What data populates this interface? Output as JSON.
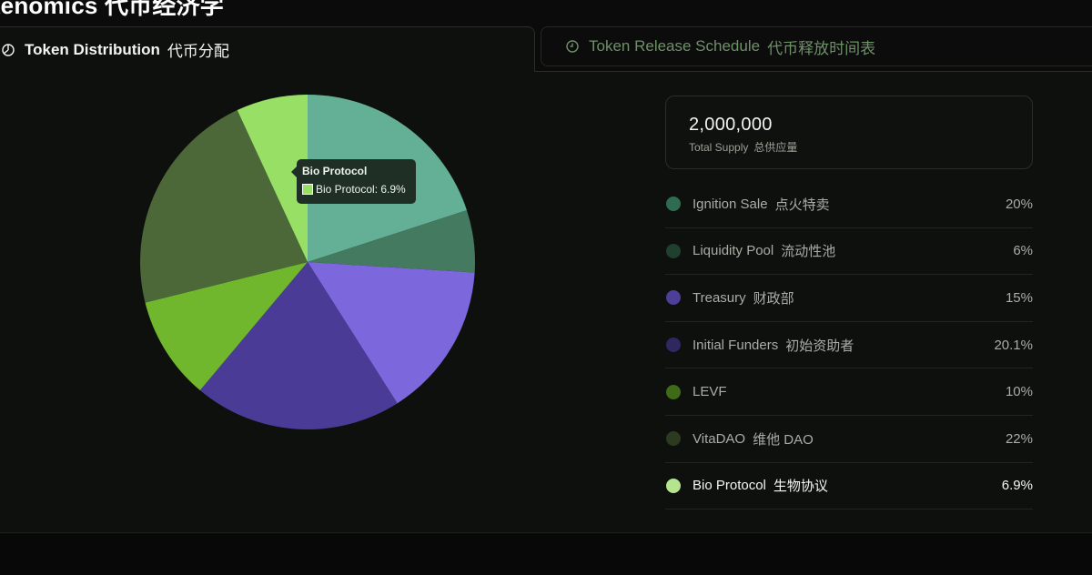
{
  "heading": "kenomics 代币经济学",
  "tabs": [
    {
      "label": "Token Distribution",
      "label_cn": "代币分配",
      "icon": "pie-chart-icon",
      "active": true
    },
    {
      "label": "Token Release Schedule",
      "label_cn": "代币释放时间表",
      "icon": "clock-icon",
      "active": false
    }
  ],
  "supply": {
    "value": "2,000,000",
    "label": "Total Supply",
    "label_cn": "总供应量"
  },
  "legend": [
    {
      "name": "Ignition Sale",
      "name_cn": "点火特卖",
      "pct": "20%",
      "color": "#2f6b50",
      "active": false
    },
    {
      "name": "Liquidity Pool",
      "name_cn": "流动性池",
      "pct": "6%",
      "color": "#1f3f2f",
      "active": false
    },
    {
      "name": "Treasury",
      "name_cn": "财政部",
      "pct": "15%",
      "color": "#4d3f98",
      "active": false
    },
    {
      "name": "Initial Funders",
      "name_cn": "初始资助者",
      "pct": "20.1%",
      "color": "#2e2760",
      "active": false
    },
    {
      "name": "LEVF",
      "name_cn": "",
      "pct": "10%",
      "color": "#3f6a18",
      "active": false
    },
    {
      "name": "VitaDAO",
      "name_cn": "维他 DAO",
      "pct": "22%",
      "color": "#2c3a20",
      "active": false
    },
    {
      "name": "Bio Protocol",
      "name_cn": "生物协议",
      "pct": "6.9%",
      "color": "#b4e58e",
      "active": true
    }
  ],
  "chart_data": {
    "type": "pie",
    "title": "",
    "slices": [
      {
        "label": "Ignition Sale",
        "value": 20,
        "color": "#63b097"
      },
      {
        "label": "Liquidity Pool",
        "value": 6,
        "color": "#447a60"
      },
      {
        "label": "Treasury",
        "value": 15,
        "color": "#7d67dc"
      },
      {
        "label": "Initial Funders",
        "value": 20.1,
        "color": "#4a3b97"
      },
      {
        "label": "LEVF",
        "value": 10,
        "color": "#70b72d"
      },
      {
        "label": "VitaDAO",
        "value": 22,
        "color": "#4c6738"
      },
      {
        "label": "Bio Protocol",
        "value": 6.9,
        "color": "#97e065"
      }
    ],
    "start_angle_deg": 0,
    "direction": "clockwise"
  },
  "tooltip": {
    "title": "Bio Protocol",
    "text": "Bio Protocol: 6.9%"
  }
}
